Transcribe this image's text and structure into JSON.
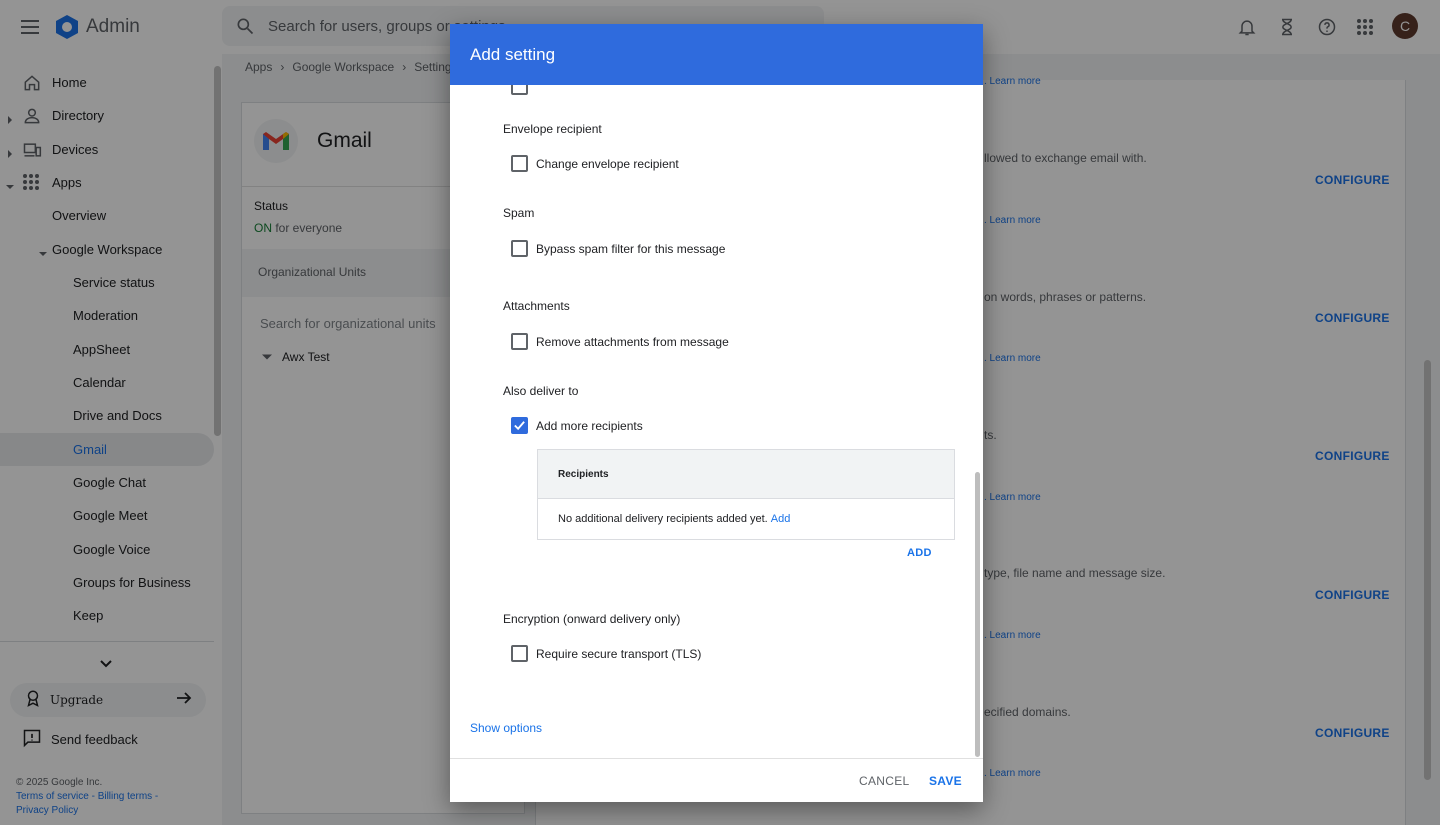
{
  "topbar": {
    "app_name": "Admin",
    "search_placeholder": "Search for users, groups or settings",
    "avatar_initial": "C"
  },
  "sidebar": {
    "items": [
      {
        "label": "Home",
        "icon": "home-icon"
      },
      {
        "label": "Directory",
        "icon": "person-icon"
      },
      {
        "label": "Devices",
        "icon": "devices-icon"
      },
      {
        "label": "Apps",
        "icon": "apps-grid-icon"
      },
      {
        "label": "Overview"
      },
      {
        "label": "Google Workspace"
      },
      {
        "label": "Service status"
      },
      {
        "label": "Moderation"
      },
      {
        "label": "AppSheet"
      },
      {
        "label": "Calendar"
      },
      {
        "label": "Drive and Docs"
      },
      {
        "label": "Gmail"
      },
      {
        "label": "Google Chat"
      },
      {
        "label": "Google Meet"
      },
      {
        "label": "Google Voice"
      },
      {
        "label": "Groups for Business"
      },
      {
        "label": "Keep"
      }
    ],
    "upgrade_label": "Upgrade",
    "feedback_label": "Send feedback",
    "footer": {
      "copyright": "© 2025 Google Inc.",
      "terms": "Terms of service",
      "billing": "Billing terms",
      "privacy": "Privacy Policy",
      "sep1": " - ",
      "sep2": " -"
    }
  },
  "breadcrumb": [
    "Apps",
    "Google Workspace",
    "Settings"
  ],
  "app_card": {
    "title": "Gmail",
    "status_label": "Status",
    "status_on": "ON",
    "status_rest": " for everyone",
    "ou_label": "Organizational Units",
    "ou_search_placeholder": "Search for organizational units",
    "ou_root": "Awx Test"
  },
  "background": {
    "lines": [
      "llowed to exchange email with.",
      "on words, phrases or patterns.",
      "ts.",
      "type, file name and message size.",
      "ecified domains."
    ],
    "learn_more": ". Learn more",
    "configure": "CONFIGURE"
  },
  "dialog": {
    "title": "Add setting",
    "sections": {
      "envelope": {
        "title": "Envelope recipient",
        "option": "Change envelope recipient",
        "checked": false
      },
      "spam": {
        "title": "Spam",
        "option": "Bypass spam filter for this message",
        "checked": false
      },
      "attachments": {
        "title": "Attachments",
        "option": "Remove attachments from message",
        "checked": false
      },
      "also_deliver": {
        "title": "Also deliver to",
        "option": "Add more recipients",
        "checked": true
      },
      "encryption": {
        "title": "Encryption (onward delivery only)",
        "option": "Require secure transport (TLS)",
        "checked": false
      }
    },
    "recipients": {
      "header": "Recipients",
      "empty_text": "No additional delivery recipients added yet.",
      "empty_link": "Add",
      "add_button": "ADD"
    },
    "show_options": "Show options",
    "cancel": "CANCEL",
    "save": "SAVE"
  },
  "colors": {
    "accent": "#1a73e8",
    "dialog_header": "#2f6bdd",
    "status_on": "#188038"
  }
}
